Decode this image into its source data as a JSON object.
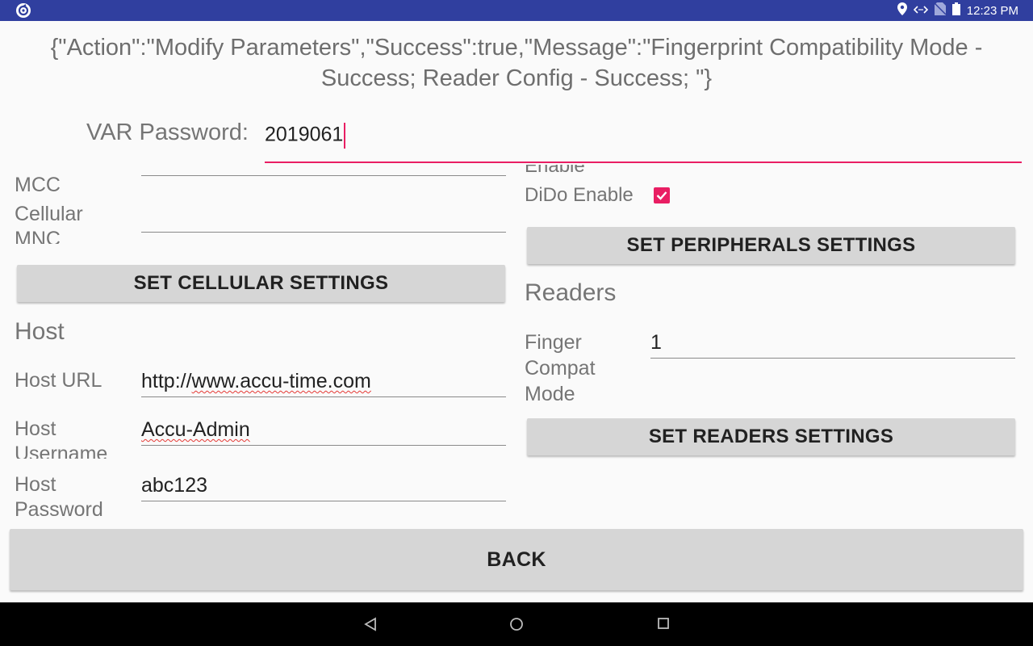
{
  "status_bar": {
    "time": "12:23 PM",
    "icons": [
      "location-icon",
      "code-arrows-icon",
      "no-sim-icon",
      "battery-icon"
    ]
  },
  "response_message": "{\"Action\":\"Modify Parameters\",\"Success\":true,\"Message\":\"Fingerprint Compatibility Mode - Success; Reader Config - Success; \"}",
  "var_password": {
    "label": "VAR Password:",
    "value": "2019061"
  },
  "cellular": {
    "mcc_label": "MCC",
    "mnc_label": "Cellular MNC",
    "mcc_value": "",
    "mnc_value": "",
    "button_label": "SET CELLULAR SETTINGS"
  },
  "host": {
    "section_title": "Host",
    "url_label": "Host URL",
    "url_value_prefix": "http://",
    "url_value_link": "www.accu-time.com",
    "username_label": "Host Username",
    "username_value": "Accu-Admin",
    "password_label": "Host Password",
    "password_value": "abc123"
  },
  "peripherals": {
    "partial_label": "Enable",
    "dido_label": "DiDo Enable",
    "dido_checked": true,
    "button_label": "SET PERIPHERALS SETTINGS"
  },
  "readers": {
    "section_title": "Readers",
    "finger_label": "Finger Compat Mode",
    "finger_value": "1",
    "button_label": "SET READERS SETTINGS"
  },
  "back_button": "BACK",
  "colors": {
    "status_bar": "#303f9f",
    "accent": "#e91e63",
    "button": "#d6d6d6"
  }
}
